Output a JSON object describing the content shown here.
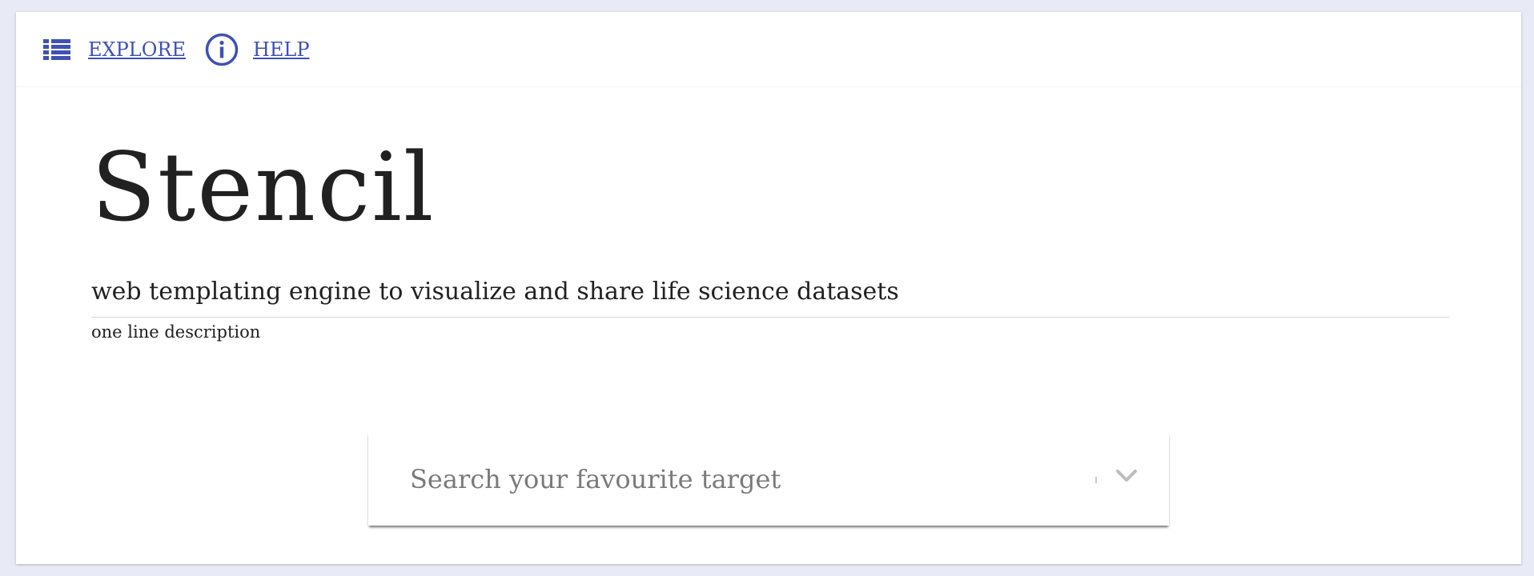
{
  "nav": {
    "explore_label": "EXPLORE",
    "help_label": "HELP",
    "explore_icon": "list-icon",
    "help_icon": "info-icon"
  },
  "hero": {
    "title": "Stencil",
    "description_value": "web templating engine to visualize and share life science datasets",
    "description_hint": "one line description"
  },
  "search": {
    "placeholder": "Search your favourite target",
    "dropdown_icon": "chevron-down-icon"
  },
  "colors": {
    "accent": "#3f51b5",
    "page_background": "#e8eaf6",
    "text": "#212121"
  }
}
